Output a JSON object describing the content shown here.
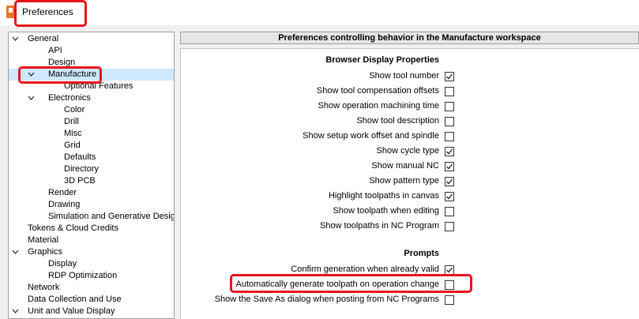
{
  "window": {
    "title": "Preferences"
  },
  "tree": [
    {
      "label": "General",
      "expanded": true,
      "level": 0
    },
    {
      "label": "API",
      "level": 1
    },
    {
      "label": "Design",
      "level": 1
    },
    {
      "label": "Manufacture",
      "expanded": true,
      "selected": true,
      "level": 1
    },
    {
      "label": "Optional Features",
      "level": 2
    },
    {
      "label": "Electronics",
      "expanded": true,
      "level": 1
    },
    {
      "label": "Color",
      "level": 2
    },
    {
      "label": "Drill",
      "level": 2
    },
    {
      "label": "Misc",
      "level": 2
    },
    {
      "label": "Grid",
      "level": 2
    },
    {
      "label": "Defaults",
      "level": 2
    },
    {
      "label": "Directory",
      "level": 2
    },
    {
      "label": "3D PCB",
      "level": 2
    },
    {
      "label": "Render",
      "level": 1
    },
    {
      "label": "Drawing",
      "level": 1
    },
    {
      "label": "Simulation and Generative Design",
      "level": 1
    },
    {
      "label": "Tokens & Cloud Credits",
      "level": 0
    },
    {
      "label": "Material",
      "level": 0
    },
    {
      "label": "Graphics",
      "expanded": true,
      "level": 0
    },
    {
      "label": "Display",
      "level": 1
    },
    {
      "label": "RDP Optimization",
      "level": 1
    },
    {
      "label": "Network",
      "level": 0
    },
    {
      "label": "Data Collection and Use",
      "level": 0
    },
    {
      "label": "Unit and Value Display",
      "expanded": true,
      "level": 0
    }
  ],
  "panel": {
    "header": "Preferences controlling behavior in the Manufacture workspace",
    "sections": [
      {
        "title": "Browser Display Properties",
        "options": [
          {
            "label": "Show tool number",
            "checked": true
          },
          {
            "label": "Show tool compensation offsets",
            "checked": false
          },
          {
            "label": "Show operation machining time",
            "checked": false
          },
          {
            "label": "Show tool description",
            "checked": false
          },
          {
            "label": "Show setup work offset and spindle",
            "checked": false
          },
          {
            "label": "Show cycle type",
            "checked": true
          },
          {
            "label": "Show manual NC",
            "checked": true
          },
          {
            "label": "Show pattern type",
            "checked": true
          },
          {
            "label": "Highlight toolpaths in canvas",
            "checked": true
          },
          {
            "label": "Show toolpath when editing",
            "checked": false
          },
          {
            "label": "Show toolpaths in NC Program",
            "checked": false
          }
        ]
      },
      {
        "title": "Prompts",
        "options": [
          {
            "label": "Confirm generation when already valid",
            "checked": true
          },
          {
            "label": "Automatically generate toolpath on operation change",
            "checked": false
          },
          {
            "label": "Show the Save As dialog when posting from NC Programs",
            "checked": false
          }
        ]
      }
    ]
  },
  "icons": {
    "app": "fusion-app-icon",
    "expand": "chevron-down-icon",
    "check": "checkmark-icon"
  },
  "colors": {
    "highlight": "#e8141c",
    "selection": "#cde8ff",
    "app_icon": "#e8762a"
  }
}
